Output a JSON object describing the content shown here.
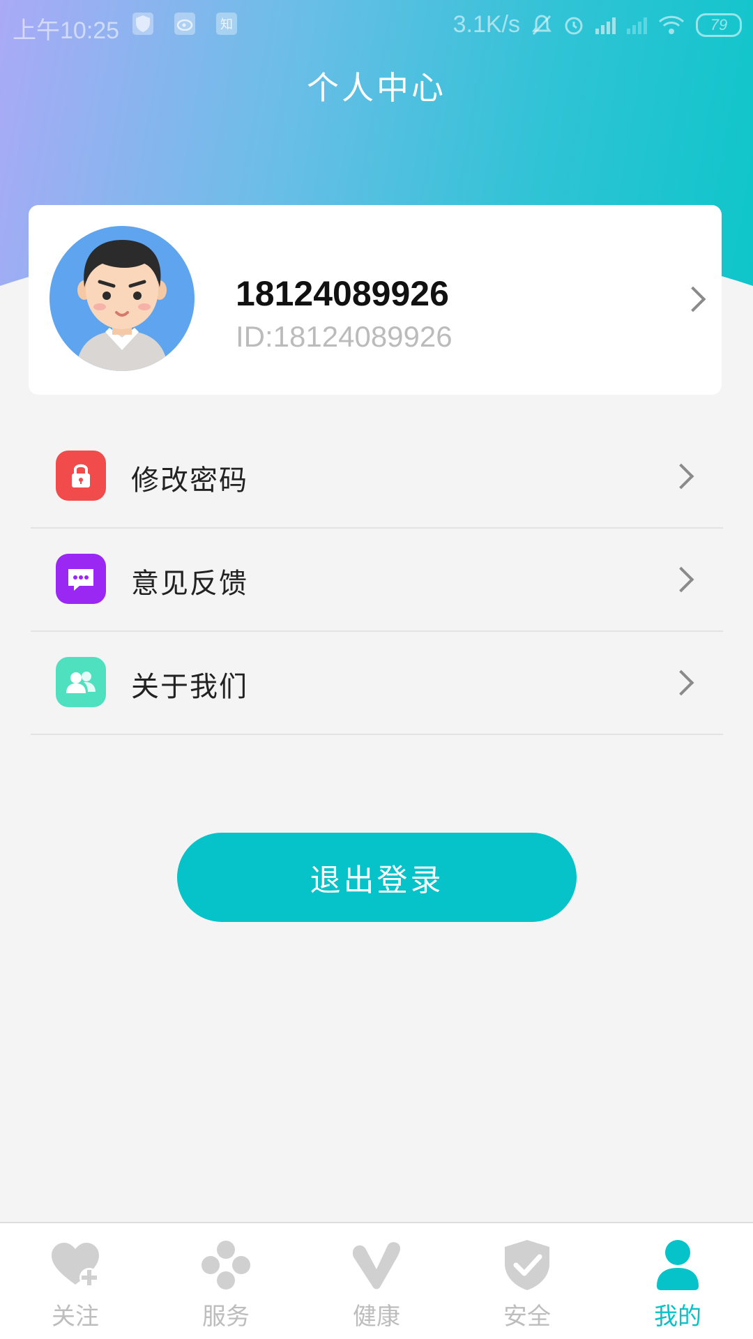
{
  "status_bar": {
    "time": "上午10:25",
    "left_icons": [
      "shield-icon",
      "weibo-icon",
      "zhihu-icon"
    ],
    "zhihu_label": "知",
    "speed": "3.1K/s",
    "battery": "79"
  },
  "header": {
    "title": "个人中心"
  },
  "profile": {
    "phone": "18124089926",
    "id": "ID:18124089926"
  },
  "menu": {
    "items": [
      {
        "label": "修改密码",
        "icon": "lock-icon",
        "color": "#f24b4b"
      },
      {
        "label": "意见反馈",
        "icon": "chat-icon",
        "color": "#9b27f3"
      },
      {
        "label": "关于我们",
        "icon": "people-icon",
        "color": "#4fe0c0"
      }
    ]
  },
  "logout": {
    "label": "退出登录"
  },
  "bottom_nav": {
    "items": [
      {
        "label": "关注",
        "icon": "heart-plus-icon",
        "active": false
      },
      {
        "label": "服务",
        "icon": "clover-icon",
        "active": false
      },
      {
        "label": "健康",
        "icon": "check-mark-icon",
        "active": false
      },
      {
        "label": "安全",
        "icon": "shield-check-icon",
        "active": false
      },
      {
        "label": "我的",
        "icon": "user-icon",
        "active": true
      }
    ]
  },
  "colors": {
    "accent": "#05c3c8",
    "inactive": "#bdbdbd",
    "header_gradient_start": "#aaaaf6",
    "header_gradient_end": "#0cc6c9"
  }
}
